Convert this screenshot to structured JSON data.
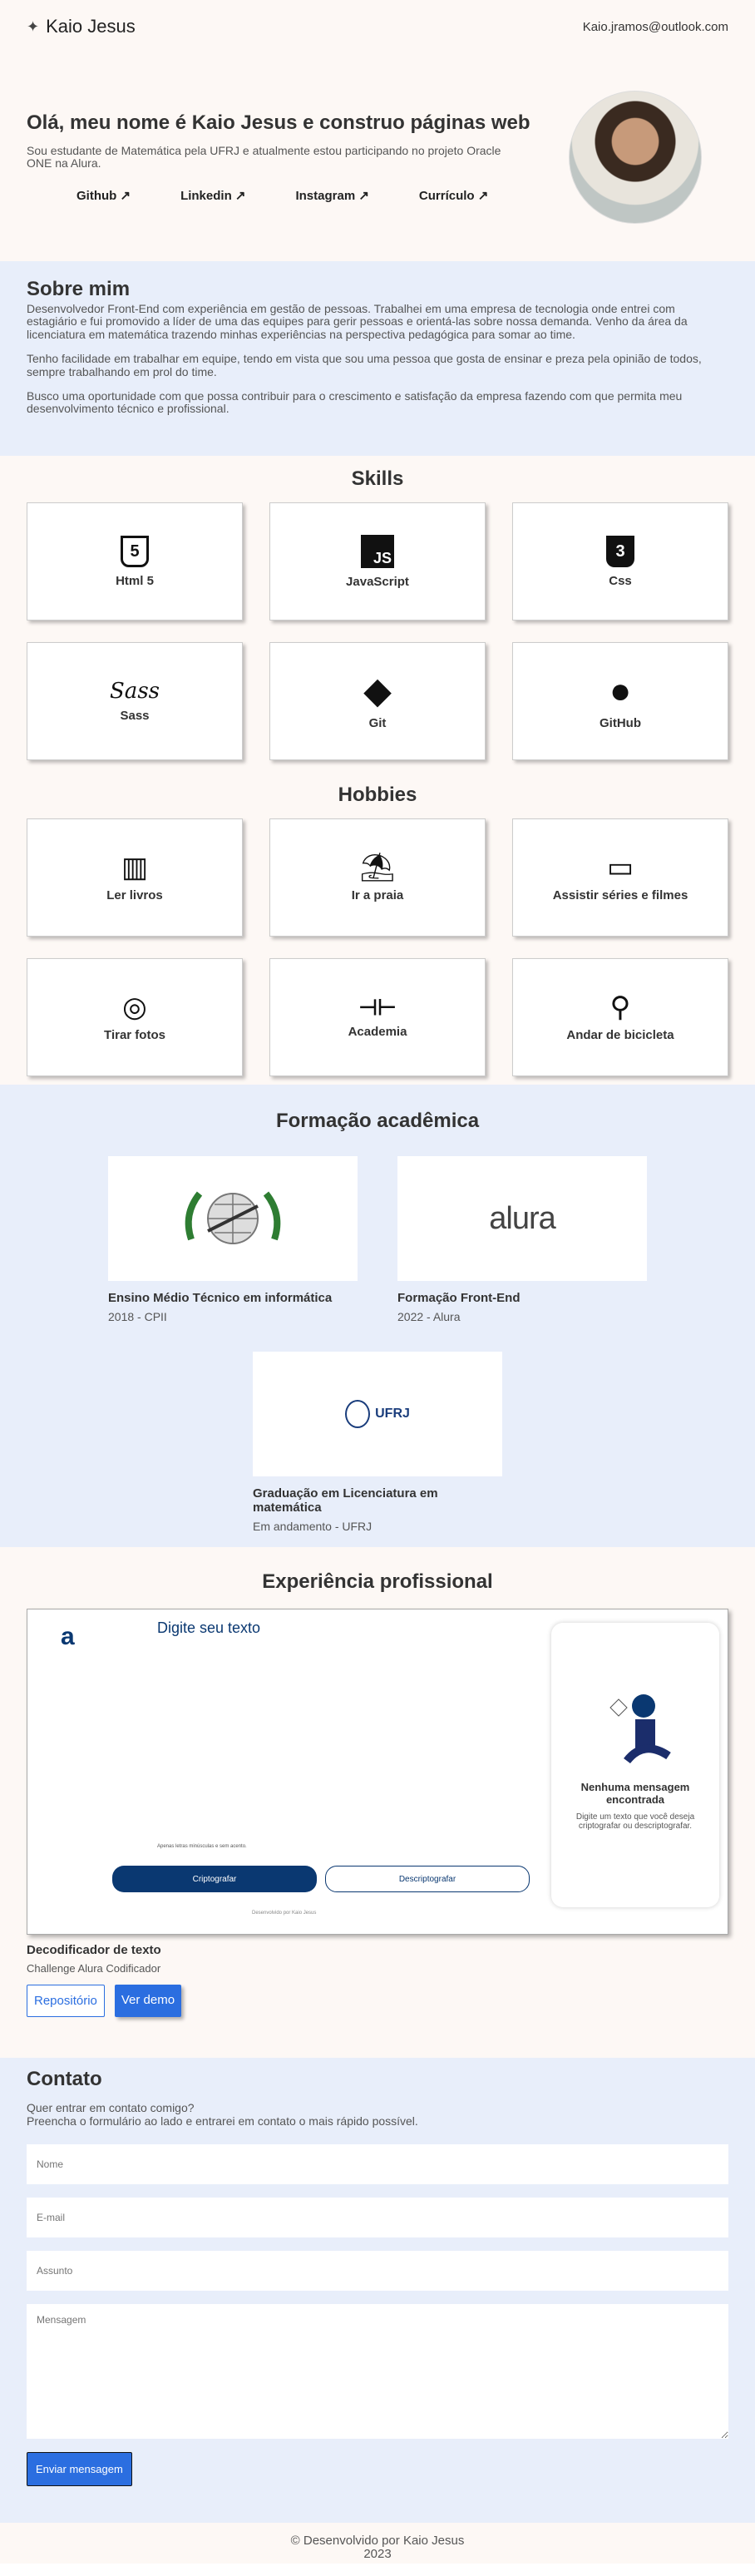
{
  "header": {
    "name": "Kaio Jesus",
    "email": "Kaio.jramos@outlook.com"
  },
  "hero": {
    "title": "Olá, meu nome é Kaio Jesus e construo páginas web",
    "subtitle": "Sou estudante de Matemática pela UFRJ e atualmente estou participando no projeto Oracle ONE na Alura.",
    "links": [
      "Github ↗",
      "Linkedin ↗",
      "Instagram ↗",
      "Currículo ↗"
    ]
  },
  "about": {
    "title": "Sobre mim",
    "paragraphs": [
      "Desenvolvedor Front-End com experiência em gestão de pessoas. Trabalhei em uma empresa de tecnologia onde entrei com estagiário e fui promovido a líder de uma das equipes para gerir pessoas e orientá-las sobre nossa demanda. Venho da área da licenciatura em matemática trazendo minhas experiências na perspectiva pedagógica para somar ao time.",
      "Tenho facilidade em trabalhar em equipe, tendo em vista que sou uma pessoa que gosta de ensinar e preza pela opinião de todos, sempre trabalhando em prol do time.",
      "Busco uma oportunidade com que possa contribuir para o crescimento e satisfação da empresa fazendo com que permita meu desenvolvimento técnico e profissional."
    ]
  },
  "skills": {
    "title": "Skills",
    "items": [
      {
        "label": "Html 5",
        "icon": "5"
      },
      {
        "label": "JavaScript",
        "icon": "JS"
      },
      {
        "label": "Css",
        "icon": "3"
      },
      {
        "label": "Sass",
        "icon": "Sass"
      },
      {
        "label": "Git",
        "icon": "◆"
      },
      {
        "label": "GitHub",
        "icon": "●"
      }
    ]
  },
  "hobbies": {
    "title": "Hobbies",
    "items": [
      {
        "label": "Ler livros",
        "icon": "▥"
      },
      {
        "label": "Ir a praia",
        "icon": "⛱"
      },
      {
        "label": "Assistir séries e filmes",
        "icon": "▭"
      },
      {
        "label": "Tirar fotos",
        "icon": "◎"
      },
      {
        "label": "Academia",
        "icon": "⊣⊢"
      },
      {
        "label": "Andar de bicicleta",
        "icon": "⚲"
      }
    ]
  },
  "education": {
    "title": "Formação acadêmica",
    "items": [
      {
        "title": "Ensino Médio Técnico em informática",
        "sub": "2018 - CPII",
        "logo": ""
      },
      {
        "title": "Formação Front-End",
        "sub": "2022 - Alura",
        "logo": "alura"
      },
      {
        "title": "Graduação em Licenciatura em matemática",
        "sub": "Em andamento - UFRJ",
        "logo": "UFRJ"
      }
    ]
  },
  "experience": {
    "title": "Experiência profissional",
    "project": {
      "app_logo": "a",
      "app_placeholder": "Digite seu texto",
      "app_hint": "Apenas letras minúsculas e sem acento.",
      "encrypt_btn": "Criptografar",
      "decrypt_btn": "Descriptografar",
      "app_footer": "Desenvolvido por Kaio Jesus",
      "panel_title": "Nenhuma mensagem encontrada",
      "panel_text": "Digite um texto que você deseja criptografar ou descriptografar.",
      "name": "Decodificador de texto",
      "desc": "Challenge Alura Codificador",
      "repo_btn": "Repositório",
      "demo_btn": "Ver demo"
    }
  },
  "contact": {
    "title": "Contato",
    "line1": "Quer entrar em contato comigo?",
    "line2": "Preencha o formulário ao lado e entrarei em contato o mais rápido possível.",
    "name_ph": "Nome",
    "email_ph": "E-mail",
    "subject_ph": "Assunto",
    "message_ph": "Mensagem",
    "send_btn": "Enviar mensagem"
  },
  "footer": {
    "line1": "© Desenvolvido por Kaio Jesus",
    "line2": "2023"
  }
}
